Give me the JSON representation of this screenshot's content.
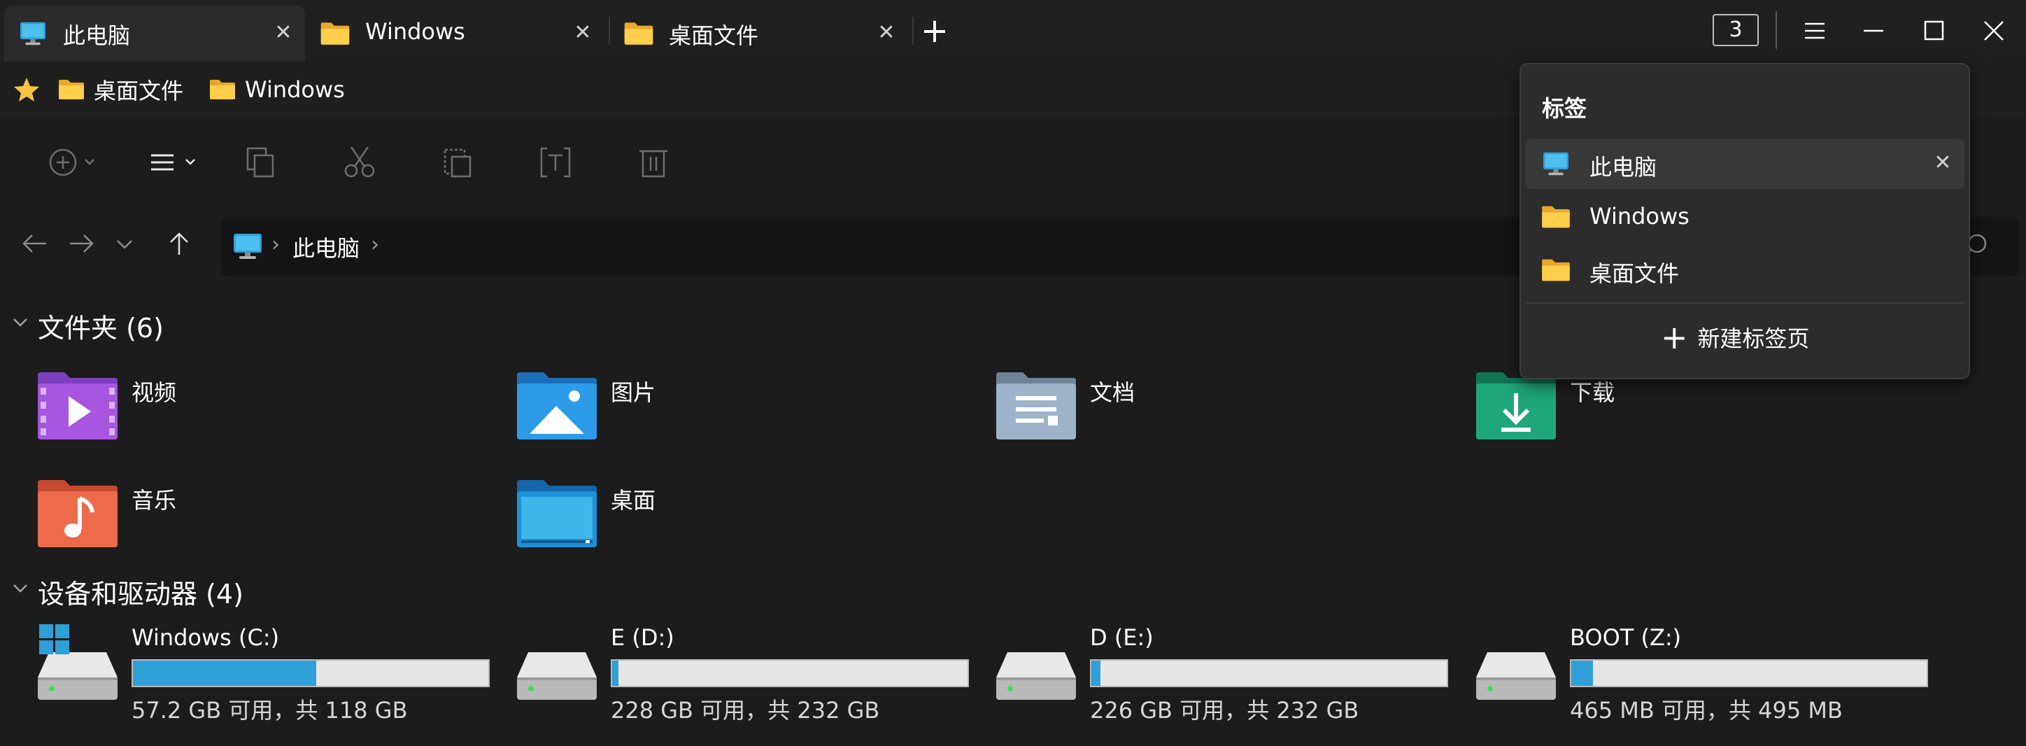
{
  "tabs": [
    {
      "label": "此电脑",
      "icon": "monitor-icon",
      "active": true
    },
    {
      "label": "Windows",
      "icon": "folder-icon",
      "active": false
    },
    {
      "label": "桌面文件",
      "icon": "folder-icon",
      "active": false
    }
  ],
  "tab_close_glyph": "✕",
  "new_tab_glyph": "+",
  "tab_count": "3",
  "favorites": [
    {
      "label": "桌面文件",
      "icon": "folder-icon"
    },
    {
      "label": "Windows",
      "icon": "folder-icon"
    }
  ],
  "address": {
    "location": "此电脑",
    "chevron": "›"
  },
  "sections": {
    "folders_title": "文件夹 (6)",
    "drives_title": "设备和驱动器 (4)"
  },
  "folders": [
    {
      "name": "视频",
      "icon": "videos-folder-icon",
      "color": "#a855e0"
    },
    {
      "name": "图片",
      "icon": "pictures-folder-icon",
      "color": "#2e9be8"
    },
    {
      "name": "文档",
      "icon": "documents-folder-icon",
      "color": "#9fb3c8"
    },
    {
      "name": "下载",
      "icon": "downloads-folder-icon",
      "color": "#1fa67a"
    },
    {
      "name": "音乐",
      "icon": "music-folder-icon",
      "color": "#ec6b4a"
    },
    {
      "name": "桌面",
      "icon": "desktop-folder-icon",
      "color": "#1e90d8"
    }
  ],
  "drives": [
    {
      "name": "Windows (C:)",
      "info": "57.2 GB 可用，共 118 GB",
      "used_fraction": 0.515,
      "system": true
    },
    {
      "name": "E (D:)",
      "info": "228 GB 可用，共 232 GB",
      "used_fraction": 0.017,
      "system": false
    },
    {
      "name": "D (E:)",
      "info": "226 GB 可用，共 232 GB",
      "used_fraction": 0.026,
      "system": false
    },
    {
      "name": "BOOT (Z:)",
      "info": "465 MB 可用，共 495 MB",
      "used_fraction": 0.061,
      "system": false
    }
  ],
  "popup": {
    "title": "标签",
    "items": [
      {
        "label": "此电脑",
        "icon": "monitor-icon",
        "active": true
      },
      {
        "label": "Windows",
        "icon": "folder-icon",
        "active": false
      },
      {
        "label": "桌面文件",
        "icon": "folder-icon",
        "active": false
      }
    ],
    "new_tab_label": "新建标签页",
    "new_tab_glyph": "+"
  },
  "colors": {
    "background": "#1c1c1c",
    "tab_active": "#2b2b2b",
    "accent_bar": "#2f9fd8",
    "folder_yellow": "#f4c542"
  }
}
